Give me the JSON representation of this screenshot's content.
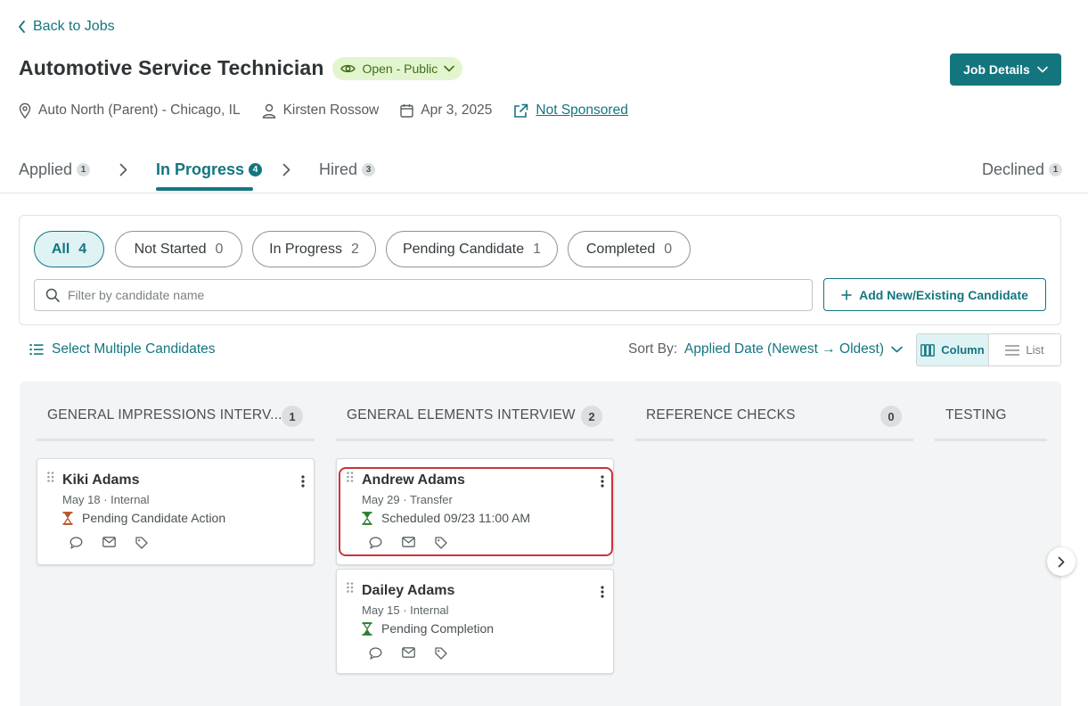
{
  "nav": {
    "back_label": "Back to Jobs"
  },
  "job": {
    "title": "Automotive Service Technician",
    "status": "Open - Public",
    "details_button": "Job Details",
    "location": "Auto North (Parent) - Chicago, IL",
    "recruiter": "Kirsten Rossow",
    "date": "Apr 3, 2025",
    "sponsorship": "Not Sponsored"
  },
  "stage_tabs": [
    {
      "label": "Applied",
      "count": "1"
    },
    {
      "label": "In Progress",
      "count": "4",
      "active": true
    },
    {
      "label": "Hired",
      "count": "3"
    },
    {
      "label": "Declined",
      "count": "1"
    }
  ],
  "filter_chips": [
    {
      "label": "All",
      "count": "4",
      "active": true
    },
    {
      "label": "Not Started",
      "count": "0"
    },
    {
      "label": "In Progress",
      "count": "2"
    },
    {
      "label": "Pending Candidate",
      "count": "1"
    },
    {
      "label": "Completed",
      "count": "0"
    }
  ],
  "search": {
    "placeholder": "Filter by candidate name"
  },
  "add_candidate_label": "Add New/Existing Candidate",
  "toolbar": {
    "select_multiple": "Select Multiple Candidates",
    "sort_label": "Sort By:",
    "sort_value": "Applied Date (Newest → Oldest)",
    "view_column": "Column",
    "view_list": "List"
  },
  "columns": [
    {
      "title": "GENERAL IMPRESSIONS INTERV...",
      "count": "1",
      "cards": [
        {
          "name": "Kiki Adams",
          "sub": "May 18 · Internal",
          "status": "Pending Candidate Action",
          "status_color": "#b5542a"
        }
      ]
    },
    {
      "title": "GENERAL ELEMENTS INTERVIEW",
      "count": "2",
      "cards": [
        {
          "name": "Andrew Adams",
          "sub": "May 29 · Transfer",
          "status": "Scheduled 09/23 11:00 AM",
          "status_color": "#2e7d32"
        },
        {
          "name": "Dailey Adams",
          "sub": "May 15 · Internal",
          "status": "Pending Completion",
          "status_color": "#2e7d32"
        }
      ]
    },
    {
      "title": "REFERENCE CHECKS",
      "count": "0",
      "cards": []
    },
    {
      "title": "TESTING",
      "count": "",
      "cards": []
    }
  ],
  "colors": {
    "accent": "#13767f",
    "status_green_bg": "#e3f5cf",
    "highlight_red": "#c9343b"
  }
}
